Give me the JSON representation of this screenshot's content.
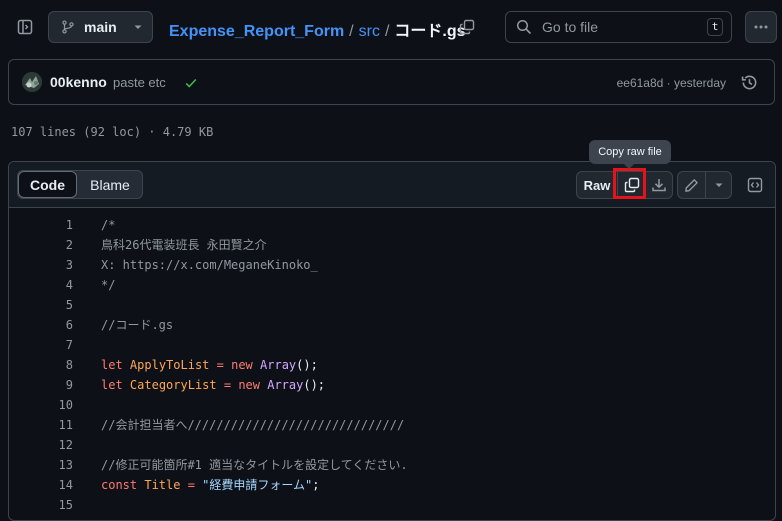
{
  "header": {
    "branch": "main",
    "breadcrumb": {
      "repo": "Expense_Report_Form",
      "sep1": "/",
      "dir": "src",
      "sep2": "/",
      "file": "コード.gs"
    },
    "search_placeholder": "Go to file",
    "search_shortcut": "t"
  },
  "commit": {
    "author": "00kenno",
    "message": "paste etc",
    "sha_time": "ee61a8d · yesterday"
  },
  "file_info": "107 lines (92 loc) · 4.79 KB",
  "toolbar": {
    "tab_code": "Code",
    "tab_blame": "Blame",
    "raw": "Raw",
    "tooltip": "Copy raw file"
  },
  "code": {
    "lines": [
      {
        "n": "1",
        "text": "/*"
      },
      {
        "n": "2",
        "text": "鳥科26代電装班長 永田賢之介"
      },
      {
        "n": "3",
        "text": "X: https://x.com/MeganeKinoko_"
      },
      {
        "n": "4",
        "text": "*/"
      },
      {
        "n": "5",
        "text": ""
      },
      {
        "n": "6",
        "text": "//コード.gs"
      },
      {
        "n": "7",
        "text": ""
      },
      {
        "n": "8",
        "kw": "let",
        "name": "ApplyToList",
        "eq": " = ",
        "new": "new",
        "fn": "Array",
        "tail": "();"
      },
      {
        "n": "9",
        "kw": "let",
        "name": "CategoryList",
        "eq": " = ",
        "new": "new",
        "fn": "Array",
        "tail": "();"
      },
      {
        "n": "10",
        "text": ""
      },
      {
        "n": "11",
        "text": "//会計担当者へ//////////////////////////////"
      },
      {
        "n": "12",
        "text": ""
      },
      {
        "n": "13",
        "text": "//修正可能箇所#1 適当なタイトルを設定してください."
      },
      {
        "n": "14",
        "kw": "const",
        "name": "Title",
        "eq": " = ",
        "str": "\"経費申請フォーム\"",
        "tail": ";"
      },
      {
        "n": "15",
        "text": ""
      }
    ]
  },
  "colors": {
    "background": "#0d1117",
    "link": "#4493f8",
    "highlight_box": "#e5131a",
    "check": "#3fb950"
  }
}
